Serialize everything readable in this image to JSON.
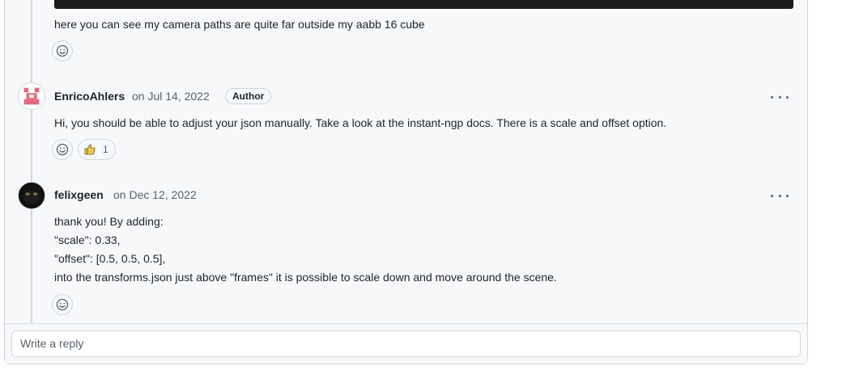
{
  "comments": [
    {
      "body": "here you can see my camera paths are quite far outside my aabb 16 cube"
    },
    {
      "author": "EnricoAhlers",
      "date": "on Jul 14, 2022",
      "badge": "Author",
      "body": "Hi, you should be able to adjust your json manually. Take a look at the instant-ngp docs. There is a scale and offset option.",
      "reactions": {
        "thumbs_up_count": "1"
      }
    },
    {
      "author": "felixgeen",
      "date": "on Dec 12, 2022",
      "body_lines": [
        "thank you! By adding:",
        "\"scale\": 0.33,",
        "\"offset\": [0.5, 0.5, 0.5],",
        "into the transforms.json just above \"frames\" it is possible to scale down and move around the scene."
      ]
    }
  ],
  "reply": {
    "placeholder": "Write a reply"
  },
  "icons": {
    "add_reaction": "smiley-icon",
    "thumbs_up": "thumbs-up-icon",
    "more": "kebab-horizontal-icon"
  },
  "colors": {
    "thumb_yellow": "#f2c94c",
    "avatar_pink": "#e06b7f"
  }
}
